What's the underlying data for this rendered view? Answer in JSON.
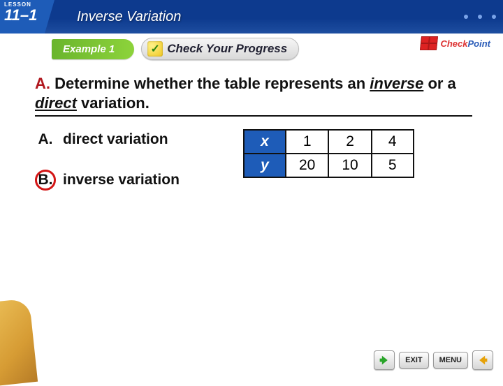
{
  "header": {
    "lesson_word": "LESSON",
    "lesson_number": "11–1",
    "title": "Inverse Variation"
  },
  "subbar": {
    "example_label": "Example 1",
    "check_label": "Check Your Progress"
  },
  "checkpoint": {
    "check": "Check",
    "point": "Point"
  },
  "question": {
    "prefix": "A.",
    "body_1": "Determine whether the table represents an ",
    "inverse": "inverse",
    "mid": " or a ",
    "direct": "direct",
    "body_2": " variation."
  },
  "choices": [
    {
      "letter": "A.",
      "text": "direct variation",
      "correct": false
    },
    {
      "letter": "B.",
      "text": "inverse variation",
      "correct": true
    }
  ],
  "table": {
    "row_label_x": "x",
    "row_label_y": "y",
    "cols": [
      "1",
      "2",
      "4"
    ],
    "yvals": [
      "20",
      "10",
      "5"
    ]
  },
  "nav": {
    "exit": "EXIT",
    "menu": "MENU"
  },
  "chart_data": {
    "type": "table",
    "title": "x–y value table",
    "series": [
      {
        "name": "x",
        "values": [
          1,
          2,
          4
        ]
      },
      {
        "name": "y",
        "values": [
          20,
          10,
          5
        ]
      }
    ]
  }
}
